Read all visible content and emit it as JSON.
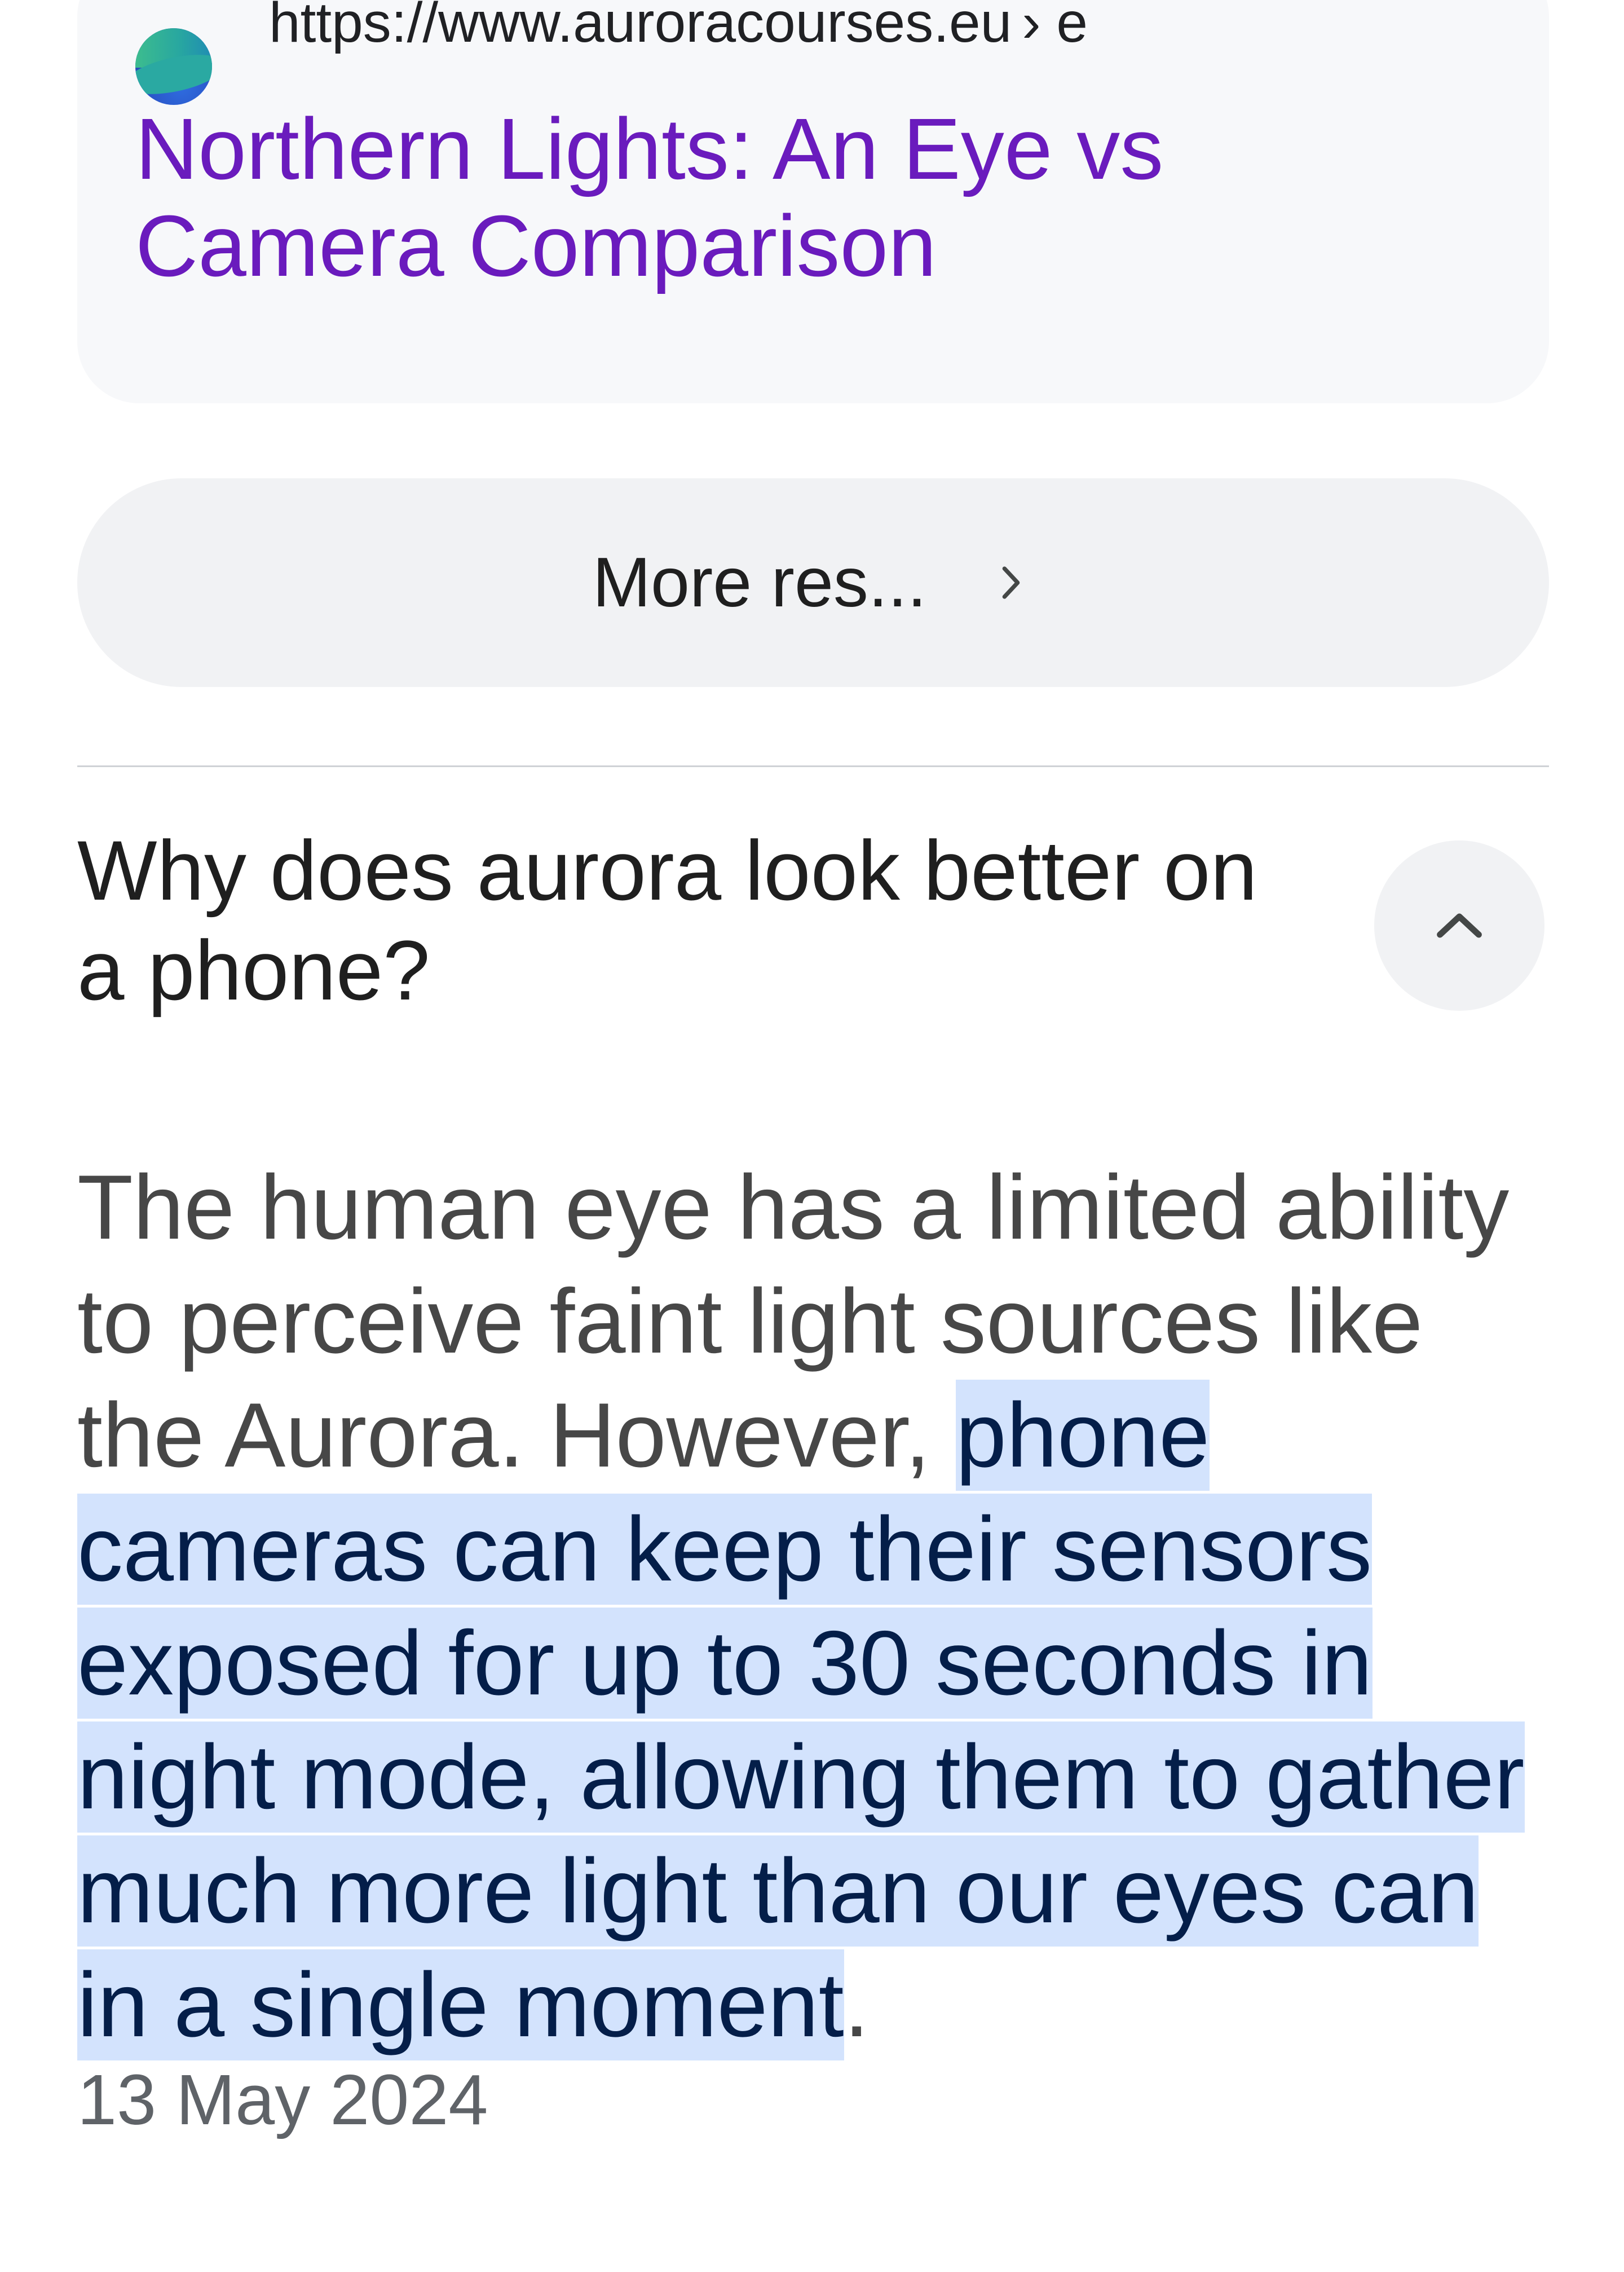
{
  "result": {
    "favicon_icon": "aurora-site-favicon",
    "url": "https://www.auroracourses.eu",
    "url_separator": "› e",
    "title": "Northern Lights: An Eye vs Camera Comparison"
  },
  "more_results": {
    "label": "More res...",
    "icon": "chevron-right-icon"
  },
  "faq": {
    "question": "Why does aurora look better on a phone?",
    "toggle_icon": "chevron-up-icon",
    "answer_intro": "The human eye has a limited ability to perceive faint light sources like the Aurora. However, ",
    "answer_highlight": "phone cameras can keep their sensors exposed for up to 30 seconds in night mode, allowing them to gather much more light than our eyes can in a single moment",
    "answer_end": ".",
    "date": "13 May 2024"
  },
  "colors": {
    "link_title": "#6a1bbd",
    "highlight_bg": "#d3e3fd",
    "highlight_text": "#041e49",
    "card_bg": "#f7f8fa",
    "pill_bg": "#f1f2f4"
  }
}
